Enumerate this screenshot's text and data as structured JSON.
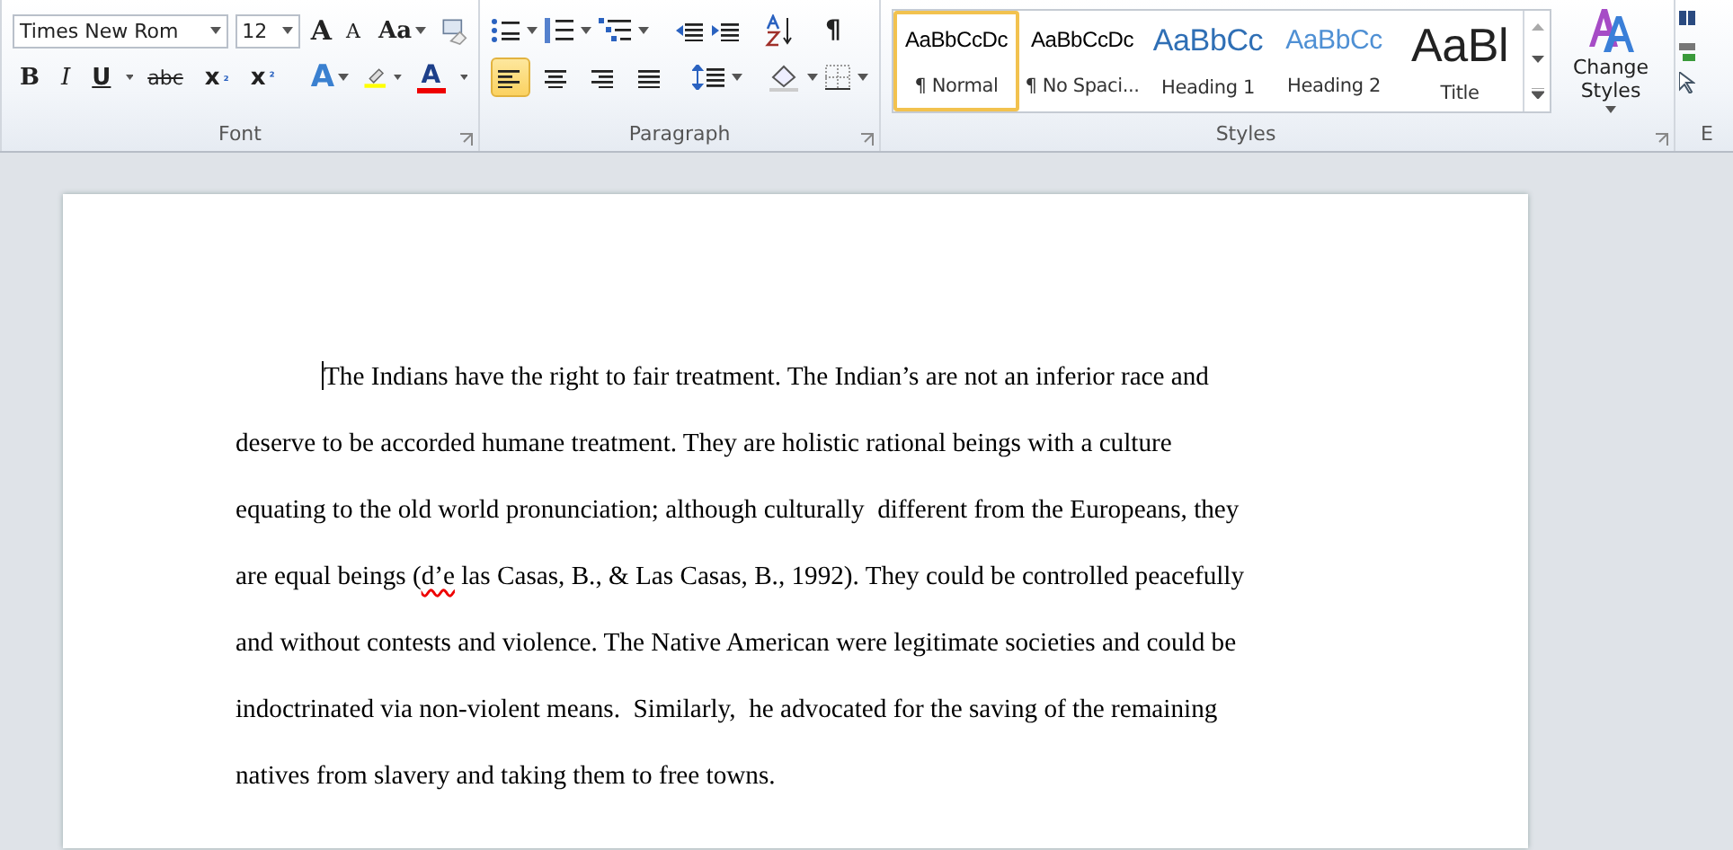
{
  "ribbon": {
    "font": {
      "label": "Font",
      "family": "Times New Rom",
      "size": "12",
      "grow": "A",
      "shrink": "A",
      "change_case": "Aa",
      "format_buttons": [
        {
          "kind": "bold",
          "label": "B"
        },
        {
          "kind": "italic",
          "label": "I"
        },
        {
          "kind": "underline",
          "label": "U"
        },
        {
          "kind": "strike",
          "label": "abc"
        },
        {
          "kind": "sub",
          "label": "x₂"
        },
        {
          "kind": "sup",
          "label": "x²"
        }
      ],
      "effects": "A",
      "font_color": "A"
    },
    "paragraph": {
      "label": "Paragraph",
      "show_marks": "¶",
      "alignments": [
        {
          "kind": "left",
          "selected": true
        },
        {
          "kind": "center",
          "selected": false
        },
        {
          "kind": "right",
          "selected": false
        },
        {
          "kind": "justify",
          "selected": false
        }
      ]
    },
    "styles": {
      "label": "Styles",
      "change_styles": "Change Styles",
      "items": [
        {
          "kind": "normal",
          "preview": "AaBbCcDc",
          "name": "¶ Normal",
          "selected": true
        },
        {
          "kind": "normal",
          "preview": "AaBbCcDc",
          "name": "¶ No Spaci...",
          "selected": false
        },
        {
          "kind": "heading1",
          "preview": "AaBbCc",
          "name": "Heading 1",
          "selected": false
        },
        {
          "kind": "heading2",
          "preview": "AaBbCc",
          "name": "Heading 2",
          "selected": false
        },
        {
          "kind": "title",
          "preview": "AaBl",
          "name": "Title",
          "selected": false
        }
      ]
    },
    "editing": {
      "label": "E"
    }
  },
  "document": {
    "text_cursor": true,
    "lines": [
      {
        "segments": [
          {
            "text": "The Indians have the right to fair treatment. The Indian’s are not an inferior race and",
            "misspelled": false
          }
        ]
      },
      {
        "segments": [
          {
            "text": "deserve to be accorded humane treatment. They are holistic rational beings with a culture",
            "misspelled": false
          }
        ]
      },
      {
        "segments": [
          {
            "text": "equating to the old world pronunciation; although culturally  different from the Europeans, they",
            "misspelled": false
          }
        ]
      },
      {
        "segments": [
          {
            "text": "are equal beings (",
            "misspelled": false
          },
          {
            "text": "d’e",
            "misspelled": true
          },
          {
            "text": " las Casas, B., & Las Casas, B., 1992). They could be controlled peacefully",
            "misspelled": false
          }
        ]
      },
      {
        "segments": [
          {
            "text": "and without contests and violence. The Native American were legitimate societies and could be",
            "misspelled": false
          }
        ]
      },
      {
        "segments": [
          {
            "text": "indoctrinated via non-violent means.  Similarly,  he advocated for the saving of the remaining",
            "misspelled": false
          }
        ]
      },
      {
        "segments": [
          {
            "text": "natives from slavery and taking them to free towns.",
            "misspelled": false
          }
        ]
      }
    ]
  }
}
